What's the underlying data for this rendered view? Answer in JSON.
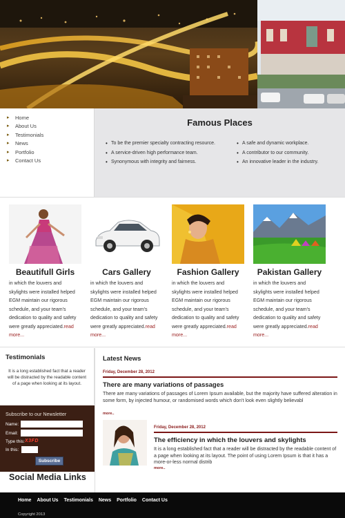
{
  "nav": {
    "items": [
      "Home",
      "About Us",
      "Testimonials",
      "News",
      "Portfolio",
      "Contact Us"
    ]
  },
  "famous": {
    "title": "Famous Places",
    "left": [
      "To be the premier specialty contracting resource.",
      "A service-driven high performance team.",
      "Synonymous with integrity and fairness."
    ],
    "right": [
      "A safe and dynamic workplace.",
      "A contributor to our community.",
      "An innovative leader in the industry."
    ]
  },
  "gallery": [
    {
      "title": "Beautifull Girls",
      "text": "in which the louvers and skylights were installed helped EGM maintain our rigorous schedule, and your team's dedication to quality and safety were greatly appreciated.",
      "more": "read more..."
    },
    {
      "title": "Cars Gallery",
      "text": "in which the louvers and skylights were installed helped EGM maintain our rigorous schedule, and your team's dedication to quality and safety were greatly appreciated.",
      "more": "read more..."
    },
    {
      "title": "Fashion Gallery",
      "text": "in which the louvers and skylights were installed helped EGM maintain our rigorous schedule, and your team's dedication to quality and safety were greatly appreciated.",
      "more": "read more..."
    },
    {
      "title": "Pakistan Gallery",
      "text": "in which the louvers and skylights were installed helped EGM maintain our rigorous schedule, and your team's dedication to quality and safety were greatly appreciated.",
      "more": "read more..."
    }
  ],
  "testimonials": {
    "title": "Testimonials",
    "text": "It is a long established fact that a reader will be distracted by the readable content of a page when looking at its layout."
  },
  "newsletter": {
    "title": "Subscribe to our Newsletter",
    "name_label": "Name:",
    "email_label": "Email:",
    "type_label": "Type this:",
    "captcha": "X3FD",
    "in_label": "In this:",
    "button": "Subscribe"
  },
  "social": {
    "title": "Social Media Links"
  },
  "news": {
    "title": "Latest News",
    "items": [
      {
        "date": "Friday, December 28, 2012",
        "headline": "There are many variations of passages",
        "body": "There are many variations of passages of Lorem Ipsum available, but the majority have suffered alteration in some form, by injected humour, or randomised words which don't look even slightly believabl",
        "more": "more.."
      },
      {
        "date": "Friday, December 28, 2012",
        "headline": "The efficiency in which the louvers and skylights",
        "body": "It is a long established fact that a reader will be distracted by the readable content of a page when looking at its layout. The point of using Lorem Ipsum is that it has a more-or-less normal distrib",
        "more": "more.."
      }
    ]
  },
  "footer": {
    "links": [
      "Home",
      "About Us",
      "Testimonials",
      "News",
      "Portfolio",
      "Contact Us"
    ],
    "copyright": "Copyright 2013"
  },
  "colors": {
    "accent_red": "#9b2020",
    "newsletter_bg": "#3b1f14",
    "footer_bg": "#0a0a0a",
    "famous_bg": "#e6e6e8"
  }
}
